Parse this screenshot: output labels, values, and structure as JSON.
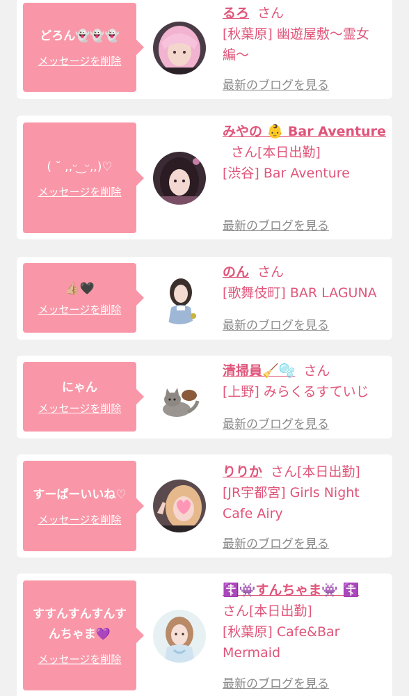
{
  "colors": {
    "accent_pink": "#f997a8",
    "name_pink": "#e0557a",
    "link_gray": "#8a8a8a",
    "page_bg": "#f1f1f1"
  },
  "labels": {
    "delete": "メッセージを削除",
    "blog": "最新のブログを見る",
    "san": "さん"
  },
  "cards": [
    {
      "message": "どろん👻👻👻",
      "name": "るろ",
      "suffix": "さん",
      "shop": "[秋葉原] 幽遊屋敷〜霊女編〜",
      "avatar_icon": "avatar-pink-hair-girl"
    },
    {
      "message": "( ˘ ,,ᵕ ͜ ᵕ,,)♡",
      "name": "みやの 👶 Bar Aventure",
      "suffix": "さん[本日出勤]",
      "shop": "[渋谷] Bar Aventure",
      "avatar_icon": "avatar-dark-hair-girl"
    },
    {
      "message": "👍🏼🖤",
      "name": "のん",
      "suffix": "さん",
      "shop": "[歌舞伎町] BAR LAGUNA",
      "avatar_icon": "avatar-uniform-girl"
    },
    {
      "message": "にゃん",
      "name": "清掃員🧹🫧",
      "suffix": "さん",
      "shop": "[上野] みらくるすていじ",
      "avatar_icon": "avatar-cat"
    },
    {
      "message": "すーぱーいいね♡",
      "name": "りりか",
      "suffix": "さん[本日出勤]",
      "shop": "[JR宇都宮] Girls Night Cafe Airy",
      "avatar_icon": "avatar-blurred-girl"
    },
    {
      "message": "すすんすんすんすんちゃま💜",
      "name": "☦️👾すんちゃま👾 ☦️",
      "suffix": "さん[本日出勤]",
      "shop": "[秋葉原] Cafe&Bar Mermaid",
      "avatar_icon": "avatar-light-outfit-girl"
    }
  ]
}
